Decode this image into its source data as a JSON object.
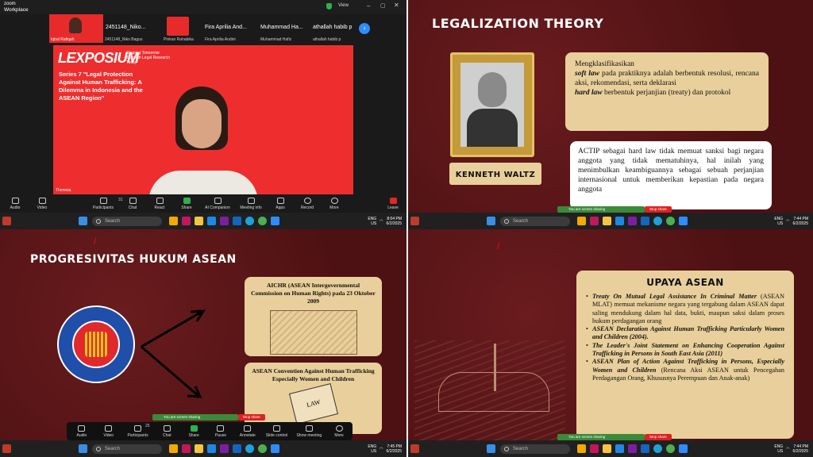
{
  "zoom": {
    "app_name_line1": "zoom",
    "app_name_line2": "Workplace",
    "view_label": "View",
    "participants": [
      {
        "name": "Iqbal Rafiqah",
        "tile_label": "2451148_Niko..."
      },
      {
        "name": "2451148_Niko Bagus",
        "tile_label": ""
      },
      {
        "name": "Pinkan Rahabika",
        "tile_label": ""
      },
      {
        "name": "Fira Aprilia Andini",
        "tile_label": "Fira Aprilia And..."
      },
      {
        "name": "Muhammad Hafiz",
        "tile_label": "Muhammad Ha..."
      },
      {
        "name": "athallah habib p",
        "tile_label": "athallah habib p"
      }
    ],
    "speaker_name": "Theresia",
    "banner": {
      "logo": "LEXPOSIUM",
      "tagline": "Shaping Tomorrow Through Legal Research Today",
      "series": "Series 7 \"Legal Protection Against Human Trafficking: A Dilemma in Indonesia and the ASEAN Region\""
    },
    "toolbar": [
      "Audio",
      "Video",
      "Participants",
      "Chat",
      "React",
      "Share",
      "AI Companion",
      "Meeting info",
      "Apps",
      "Record",
      "More",
      "Leave"
    ],
    "participants_count": "31",
    "toolbar_bottom": [
      "Audio",
      "Video",
      "Participants",
      "Chat",
      "Share",
      "Pause",
      "Annotate",
      "Slide control",
      "Show meeting",
      "More"
    ],
    "participants_count_bottom": "25"
  },
  "share_bar": {
    "sharing": "You are screen sharing",
    "stop": "Stop share"
  },
  "taskbar": {
    "search": "Search",
    "lang": "ENG",
    "region": "US",
    "clocks": [
      {
        "time": "8:04 PM",
        "date": "6/2/2025"
      },
      {
        "time": "7:44 PM",
        "date": "6/2/2025"
      },
      {
        "time": "7:45 PM",
        "date": "6/2/2025"
      },
      {
        "time": "7:44 PM",
        "date": "6/2/2025"
      }
    ]
  },
  "slide_legal": {
    "title": "LEGALIZATION THEORY",
    "portrait_name": "KENNETH WALTZ",
    "box1_intro": "Mengklasifikasikan",
    "box1_soft_term": "soft law",
    "box1_soft_text": " pada praktiknya adalah berbentuk resolusi, rencana aksi, rekomendasi, serta deklarasi",
    "box1_hard_term": "hard law",
    "box1_hard_text": " berbentuk perjanjian (treaty) dan protokol",
    "box2": "ACTIP sebagai hard law tidak memuat sanksi bagi negara anggota yang tidak mematuhinya, hal inilah yang menimbulkan keambiguannya sebagai sebuah perjanjian internasional untuk memberikan kepastian pada negara anggota"
  },
  "slide_progresivitas": {
    "title": "PROGRESIVITAS HUKUM ASEAN",
    "box1": "AICHR (ASEAN Intergovernmental Commission on Human Rights) pada 23 Oktober 2009",
    "box2": "ASEAN Convention Against Human Trafficking Especially Women and Children",
    "book_label": "LAW"
  },
  "slide_upaya": {
    "title": "UPAYA ASEAN",
    "items": [
      {
        "bold": "Treaty On Mutual Legal Assistance In Criminal Matter",
        "text": " (ASEAN MLAT) memuat mekanisme negara yang tergabung dalam ASEAN dapat saling mendukung dalam hal data, bukti, maupun saksi dalam proses hukum perdagangan orang"
      },
      {
        "bold": "ASEAN Declaration Against Human Trafficking Particularly Women and Children (2004).",
        "text": ""
      },
      {
        "bold": "The Leader's Joint Statement on Enhancing Cooperation Against Trafficking in Persons in South East Asia (2011)",
        "text": ""
      },
      {
        "bold": "ASEAN Plan of Action Against Trafficking in Persons, Especially Women and Children",
        "text": " (Rencana Aksi ASEAN untuk Pencegahan Perdagangan Orang, Khususnya Perempuan dan Anak-anak)"
      }
    ]
  },
  "colors": {
    "maroon": "#5a1416",
    "beige": "#e9cf9b",
    "zoom_red": "#ef2b2b",
    "asean_blue": "#1f4fa8"
  }
}
